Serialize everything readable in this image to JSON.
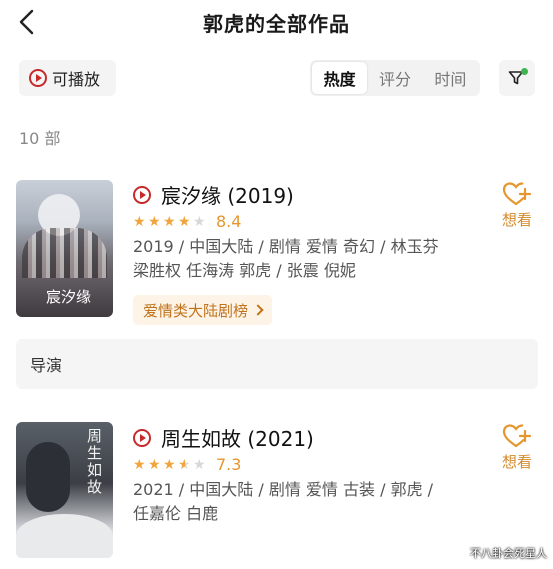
{
  "header": {
    "title": "郭虎的全部作品"
  },
  "filters": {
    "playable_label": "可播放",
    "sort_tabs": [
      {
        "label": "热度",
        "active": true
      },
      {
        "label": "评分",
        "active": false
      },
      {
        "label": "时间",
        "active": false
      }
    ],
    "filter_icon": "funnel-icon",
    "filter_active_dot_color": "#3fb34f"
  },
  "count_label": "10 部",
  "section_director_label": "导演",
  "movies": [
    {
      "title": "宸汐缘 (2019)",
      "poster_text": "宸汐缘",
      "rating_stars": 4,
      "score": "8.4",
      "meta_line1": "2019 / 中国大陆 / 剧情 爱情 奇幻 / 林玉芬",
      "meta_line2": "梁胜权 任海涛 郭虎 / 张震 倪妮",
      "tag": "爱情类大陆剧榜",
      "want_label": "想看"
    },
    {
      "title": "周生如故 (2021)",
      "poster_text": "周生如故",
      "rating_stars": 3.5,
      "score": "7.3",
      "meta_line1": "2021 / 中国大陆 / 剧情 爱情 古装 / 郭虎 /",
      "meta_line2": "任嘉伦 白鹿",
      "want_label": "想看"
    }
  ],
  "watermark": "不八卦会死星人",
  "colors": {
    "accent": "#e5962e",
    "play_red": "#c72a2a",
    "tag_bg": "#fdf3e6"
  }
}
